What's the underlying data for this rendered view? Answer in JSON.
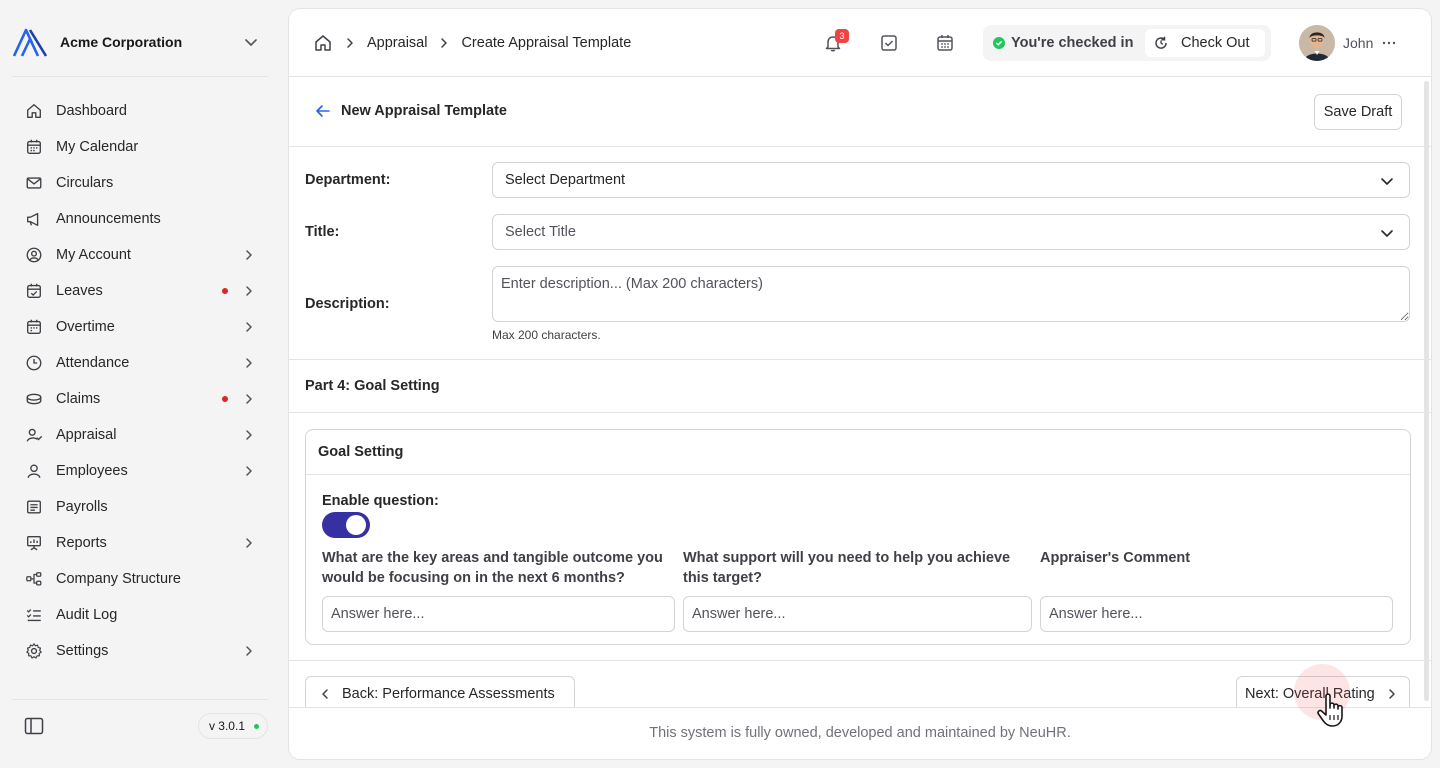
{
  "org": {
    "name": "Acme Corporation"
  },
  "sidebar": {
    "items": [
      {
        "label": "Dashboard",
        "icon": "home-icon",
        "has_submenu": false
      },
      {
        "label": "My Calendar",
        "icon": "calendar-icon",
        "has_submenu": false
      },
      {
        "label": "Circulars",
        "icon": "mail-icon",
        "has_submenu": false
      },
      {
        "label": "Announcements",
        "icon": "megaphone-icon",
        "has_submenu": false
      },
      {
        "label": "My Account",
        "icon": "user-circle-icon",
        "has_submenu": true
      },
      {
        "label": "Leaves",
        "icon": "calendar-check-icon",
        "has_submenu": true,
        "notification_dot": true
      },
      {
        "label": "Overtime",
        "icon": "calendar-clock-icon",
        "has_submenu": true
      },
      {
        "label": "Attendance",
        "icon": "clock-icon",
        "has_submenu": true
      },
      {
        "label": "Claims",
        "icon": "coins-icon",
        "has_submenu": true,
        "notification_dot": true
      },
      {
        "label": "Appraisal",
        "icon": "user-check-icon",
        "has_submenu": true
      },
      {
        "label": "Employees",
        "icon": "user-icon",
        "has_submenu": true
      },
      {
        "label": "Payrolls",
        "icon": "receipt-icon",
        "has_submenu": false
      },
      {
        "label": "Reports",
        "icon": "presentation-icon",
        "has_submenu": true
      },
      {
        "label": "Company Structure",
        "icon": "network-icon",
        "has_submenu": false
      },
      {
        "label": "Audit Log",
        "icon": "list-checks-icon",
        "has_submenu": false
      },
      {
        "label": "Settings",
        "icon": "gear-icon",
        "has_submenu": true
      }
    ],
    "version": "v 3.0.1"
  },
  "header": {
    "breadcrumb": [
      "Appraisal",
      "Create Appraisal Template"
    ],
    "notification_count": "3",
    "check_status": "You're checked in",
    "check_out_label": "Check Out",
    "user_name": "John"
  },
  "page": {
    "title": "New Appraisal Template",
    "save_draft_label": "Save Draft"
  },
  "form": {
    "department_label": "Department:",
    "department_value": "Select Department",
    "title_label": "Title:",
    "title_value": "Select Title",
    "description_label": "Description:",
    "description_placeholder": "Enter description... (Max 200 characters)",
    "description_hint": "Max 200 characters."
  },
  "part": {
    "title": "Part 4: Goal Setting",
    "card_title": "Goal Setting",
    "enable_label": "Enable question:",
    "enabled": true,
    "questions": [
      {
        "label": "What are the key areas and tangible outcome you would be focusing on in the next 6 months?",
        "placeholder": "Answer here..."
      },
      {
        "label": "What support will you need to help you achieve this target?",
        "placeholder": "Answer here..."
      },
      {
        "label": "Appraiser's Comment",
        "placeholder": "Answer here..."
      }
    ]
  },
  "navigation": {
    "back_label": "Back: Performance Assessments",
    "next_label": "Next: Overall Rating"
  },
  "footer": {
    "text": "This system is fully owned, developed and maintained by NeuHR."
  },
  "colors": {
    "toggle_on": "#3730a3",
    "badge": "#ef4444",
    "checked_in": "#22c55e",
    "dot": "#dc2626"
  }
}
